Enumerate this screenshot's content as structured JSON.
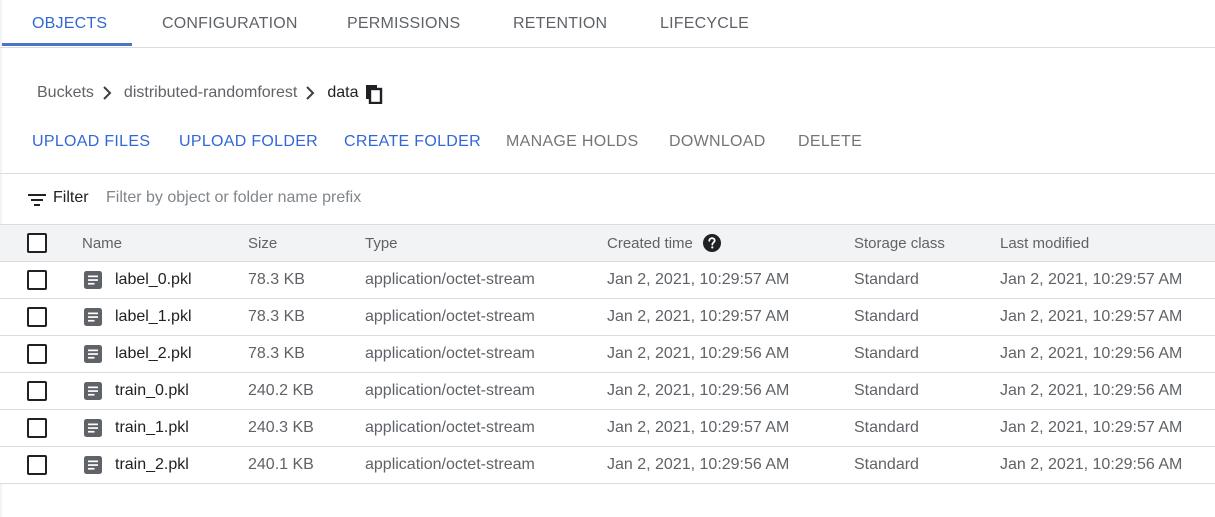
{
  "tabs": [
    {
      "label": "OBJECTS",
      "active": true
    },
    {
      "label": "CONFIGURATION",
      "active": false
    },
    {
      "label": "PERMISSIONS",
      "active": false
    },
    {
      "label": "RETENTION",
      "active": false
    },
    {
      "label": "LIFECYCLE",
      "active": false
    }
  ],
  "breadcrumb": {
    "items": [
      "Buckets",
      "distributed-randomforest",
      "data"
    ],
    "copy_icon": "copy-icon"
  },
  "actions": {
    "upload_files": "UPLOAD FILES",
    "upload_folder": "UPLOAD FOLDER",
    "create_folder": "CREATE FOLDER",
    "manage_holds": "MANAGE HOLDS",
    "download": "DOWNLOAD",
    "delete": "DELETE"
  },
  "filter": {
    "label": "Filter",
    "placeholder": "Filter by object or folder name prefix",
    "value": ""
  },
  "table": {
    "headers": {
      "name": "Name",
      "size": "Size",
      "type": "Type",
      "created": "Created time",
      "storage": "Storage class",
      "modified": "Last modified"
    },
    "rows": [
      {
        "name": "label_0.pkl",
        "size": "78.3 KB",
        "type": "application/octet-stream",
        "created": "Jan 2, 2021, 10:29:57 AM",
        "storage": "Standard",
        "modified": "Jan 2, 2021, 10:29:57 AM"
      },
      {
        "name": "label_1.pkl",
        "size": "78.3 KB",
        "type": "application/octet-stream",
        "created": "Jan 2, 2021, 10:29:57 AM",
        "storage": "Standard",
        "modified": "Jan 2, 2021, 10:29:57 AM"
      },
      {
        "name": "label_2.pkl",
        "size": "78.3 KB",
        "type": "application/octet-stream",
        "created": "Jan 2, 2021, 10:29:56 AM",
        "storage": "Standard",
        "modified": "Jan 2, 2021, 10:29:56 AM"
      },
      {
        "name": "train_0.pkl",
        "size": "240.2 KB",
        "type": "application/octet-stream",
        "created": "Jan 2, 2021, 10:29:56 AM",
        "storage": "Standard",
        "modified": "Jan 2, 2021, 10:29:56 AM"
      },
      {
        "name": "train_1.pkl",
        "size": "240.3 KB",
        "type": "application/octet-stream",
        "created": "Jan 2, 2021, 10:29:57 AM",
        "storage": "Standard",
        "modified": "Jan 2, 2021, 10:29:57 AM"
      },
      {
        "name": "train_2.pkl",
        "size": "240.1 KB",
        "type": "application/octet-stream",
        "created": "Jan 2, 2021, 10:29:56 AM",
        "storage": "Standard",
        "modified": "Jan 2, 2021, 10:29:56 AM"
      }
    ]
  },
  "colors": {
    "accent": "#3367d6",
    "tab_indicator": "#4a74c9",
    "header_bg": "#f1f3f4",
    "border": "#dadce0"
  }
}
